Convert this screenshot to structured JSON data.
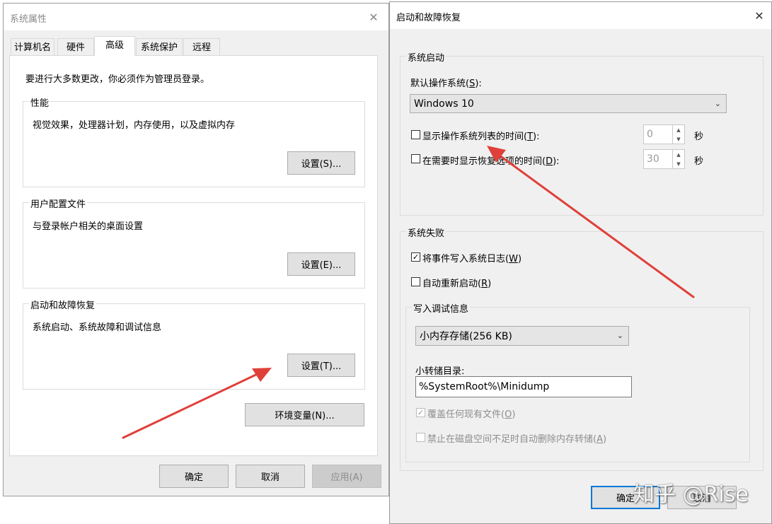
{
  "left_dialog": {
    "title": "系统属性",
    "tabs": [
      "计算机名",
      "硬件",
      "高级",
      "系统保护",
      "远程"
    ],
    "admin_notice": "要进行大多数更改，你必须作为管理员登录。",
    "performance": {
      "label": "性能",
      "description": "视觉效果，处理器计划，内存使用，以及虚拟内存",
      "button": "设置(S)..."
    },
    "user_profiles": {
      "label": "用户配置文件",
      "description": "与登录帐户相关的桌面设置",
      "button": "设置(E)..."
    },
    "startup_recovery": {
      "label": "启动和故障恢复",
      "description": "系统启动、系统故障和调试信息",
      "button": "设置(T)..."
    },
    "env_vars_button": "环境变量(N)...",
    "ok": "确定",
    "cancel": "取消",
    "apply": "应用(A)"
  },
  "right_dialog": {
    "title": "启动和故障恢复",
    "system_startup": {
      "label": "系统启动",
      "default_os_label_pre": "默认操作系统(",
      "default_os_key": "S",
      "default_os_label_post": "):",
      "default_os_value": "Windows 10",
      "show_list": {
        "pre": "显示操作系统列表的时间(",
        "key": "T",
        "post": "):",
        "value": "0",
        "unit": "秒",
        "checked": false
      },
      "show_recovery": {
        "pre": "在需要时显示恢复选项的时间(",
        "key": "D",
        "post": "):",
        "value": "30",
        "unit": "秒",
        "checked": false
      }
    },
    "system_failure": {
      "label": "系统失败",
      "write_event": {
        "pre": "将事件写入系统日志(",
        "key": "W",
        "post": ")",
        "checked": true
      },
      "auto_restart": {
        "pre": "自动重新启动(",
        "key": "R",
        "post": ")",
        "checked": false
      },
      "debug_info": {
        "label": "写入调试信息",
        "dump_type": "小内存存储(256 KB)",
        "dump_dir_label": "小转储目录:",
        "dump_dir_value": "%SystemRoot%\\Minidump",
        "overwrite": {
          "pre": "覆盖任何现有文件(",
          "key": "O",
          "post": ")",
          "checked": true,
          "disabled": true
        },
        "disable_auto_delete": {
          "pre": "禁止在磁盘空间不足时自动删除内存转储(",
          "key": "A",
          "post": ")",
          "checked": false,
          "disabled": true
        }
      }
    },
    "ok": "确定",
    "cancel": "取消"
  },
  "watermark": "知乎 @Rise",
  "colors": {
    "arrow": "#e0403a",
    "focus": "#0078d7"
  }
}
